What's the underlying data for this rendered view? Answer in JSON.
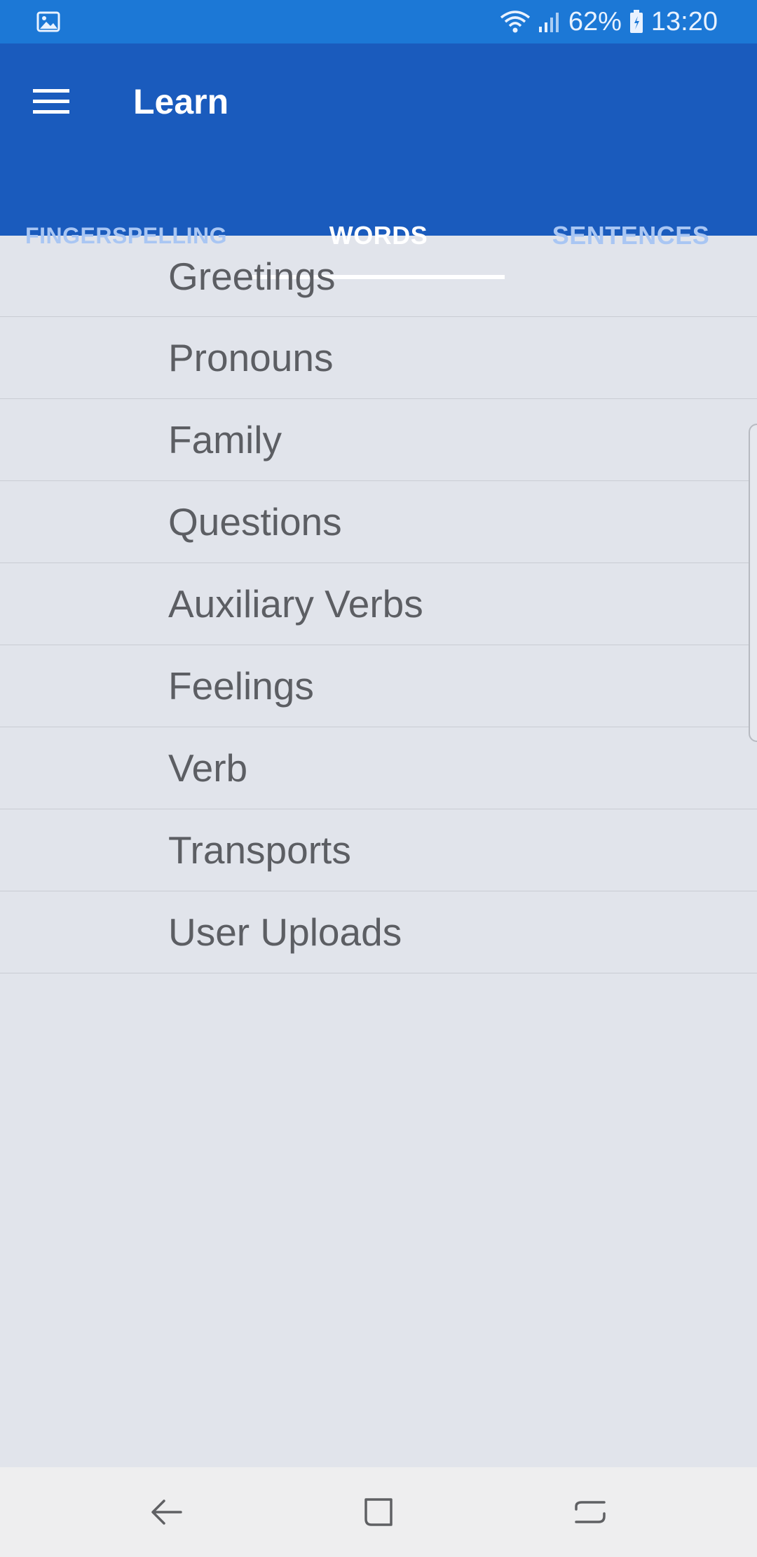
{
  "status_bar": {
    "battery": "62%",
    "time": "13:20",
    "icons": [
      "gallery-notification-icon",
      "wifi-icon",
      "signal-icon",
      "battery-icon"
    ]
  },
  "app_bar": {
    "title": "Learn",
    "menu_icon": "hamburger-menu-icon"
  },
  "tabs": [
    {
      "label": "FINGERSPELLING",
      "active": false
    },
    {
      "label": "WORDS",
      "active": true
    },
    {
      "label": "SENTENCES",
      "active": false
    }
  ],
  "list": {
    "items": [
      "Greetings",
      "Pronouns",
      "Family",
      "Questions",
      "Auxiliary Verbs",
      "Feelings",
      "Verb",
      "Transports",
      "User Uploads"
    ]
  },
  "nav_bar": {
    "icons": [
      "back-icon",
      "home-icon",
      "recents-icon"
    ]
  },
  "colors": {
    "status_bar": "#1c78d6",
    "app_bar": "#1a5bbd",
    "background": "#e1e4eb",
    "tab_inactive": "#a9c6f3",
    "tab_active": "#ffffff",
    "list_text": "#5c5e63"
  }
}
